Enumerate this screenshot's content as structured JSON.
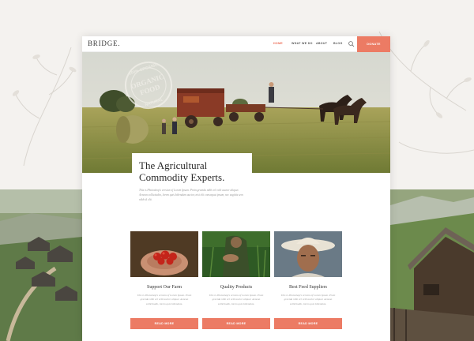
{
  "site": {
    "logo": "BRIDGE."
  },
  "nav": {
    "items": [
      "HOME",
      "WHAT WE DO",
      "ABOUT",
      "BLOG"
    ],
    "donate": "DONATE"
  },
  "hero": {
    "stamp_top": "100% ORGANIC",
    "stamp_main_1": "ORGANIC",
    "stamp_main_2": "FOOD",
    "stamp_bottom": "NATURAL"
  },
  "intro": {
    "title_line1": "The Agricultural",
    "title_line2": "Commodity Experts.",
    "body": "This is Photoshop's version of Lorem Ipsum. Proin gravida nibh vel velit auctor aliquet. Aenean sollicitudin, lorem quis bibendum auctor, nisi elit consequat ipsum, nec sagittis sem nibh id elit."
  },
  "cards": [
    {
      "title": "Support Our Farm",
      "text": "This is Photoshop's version of Lorem Ipsum. Proin gravida nibh vel velit auctor aliquet. Aenean sollicitudin, lorem quis bibendum.",
      "button": "READ MORE"
    },
    {
      "title": "Quality Products",
      "text": "This is Photoshop's version of Lorem Ipsum. Proin gravida nibh vel velit auctor aliquet. Aenean sollicitudin, lorem quis bibendum.",
      "button": "READ MORE"
    },
    {
      "title": "Best Feed Suppliers",
      "text": "This is Photoshop's version of Lorem Ipsum. Proin gravida nibh vel velit auctor aliquet. Aenean sollicitudin, lorem quis bibendum.",
      "button": "READ MORE"
    }
  ],
  "colors": {
    "accent": "#ec7b64",
    "nav_active": "#ec6b55"
  },
  "icons": {
    "search": "search-icon"
  }
}
